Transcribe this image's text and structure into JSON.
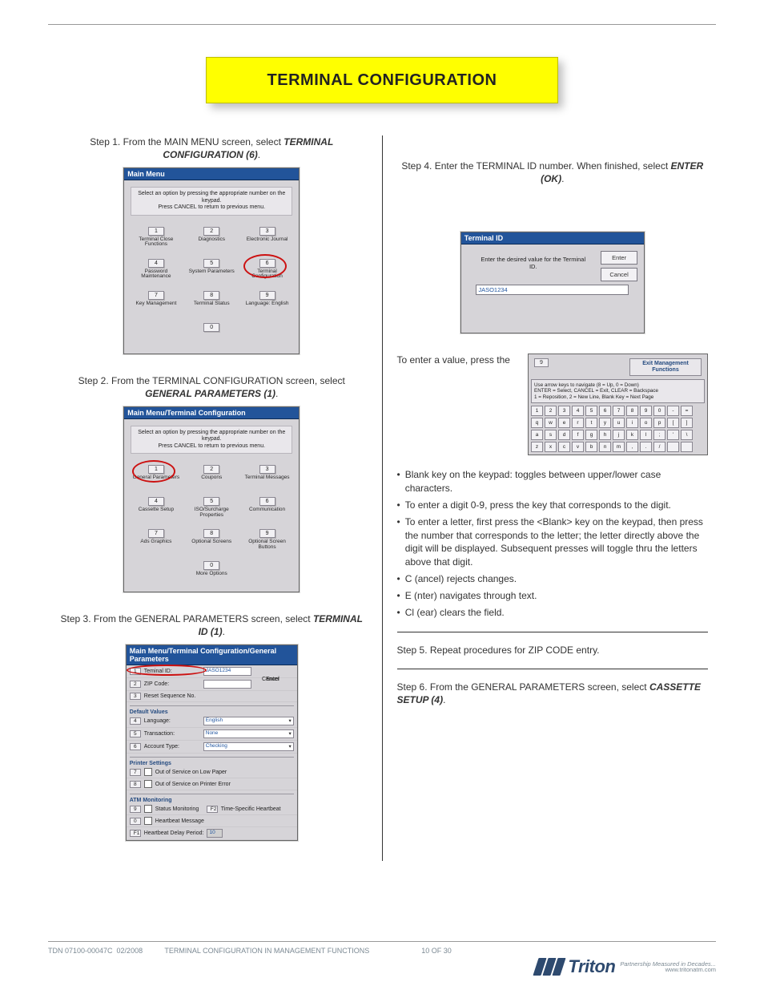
{
  "banner": "TERMINAL CONFIGURATION",
  "step1": {
    "cap_prefix": "Step 1. From the MAIN MENU screen, select ",
    "cap_hl": "TERMINAL CONFIGURATION (6)",
    "title": "Main Menu",
    "instr": "Select an option by pressing the appropriate number on the keypad.\nPress CANCEL to return to previous menu.",
    "cells": [
      {
        "n": "1",
        "l": "Terminal Close Functions"
      },
      {
        "n": "2",
        "l": "Diagnostics"
      },
      {
        "n": "3",
        "l": "Electronic Journal"
      },
      {
        "n": "4",
        "l": "Password Maintenance"
      },
      {
        "n": "5",
        "l": "System Parameters"
      },
      {
        "n": "6",
        "l": "Terminal Configuration"
      },
      {
        "n": "7",
        "l": "Key Management"
      },
      {
        "n": "8",
        "l": "Terminal Status"
      },
      {
        "n": "9",
        "l": "Language: English"
      },
      {
        "n": "",
        "l": ""
      },
      {
        "n": "0",
        "l": ""
      },
      {
        "n": "",
        "l": ""
      }
    ]
  },
  "step2": {
    "cap_prefix": "Step 2. From the TERMINAL CONFIGURATION screen, select ",
    "cap_hl": "GENERAL PARAMETERS (1)",
    "title": "Main Menu/Terminal Configuration",
    "instr": "Select an option by pressing the appropriate number on the keypad.\nPress CANCEL to return to previous menu.",
    "cells": [
      {
        "n": "1",
        "l": "General Parameters"
      },
      {
        "n": "2",
        "l": "Coupons"
      },
      {
        "n": "3",
        "l": "Terminal Messages"
      },
      {
        "n": "4",
        "l": "Cassette Setup"
      },
      {
        "n": "5",
        "l": "ISO/Surcharge Properties"
      },
      {
        "n": "6",
        "l": "Communication"
      },
      {
        "n": "7",
        "l": "Ads Graphics"
      },
      {
        "n": "8",
        "l": "Optional Screens"
      },
      {
        "n": "9",
        "l": "Optional Screen Buttons"
      },
      {
        "n": "",
        "l": ""
      },
      {
        "n": "0",
        "l": "More Options"
      },
      {
        "n": "",
        "l": ""
      }
    ]
  },
  "step3": {
    "cap_prefix": "Step 3. From the GENERAL PARAMETERS screen, select ",
    "cap_hl": "TERMINAL ID (1)",
    "title": "Main Menu/Terminal Configuration/General Parameters",
    "rows": [
      {
        "n": "1",
        "lab": "Teminal ID:",
        "val": "JASO1234"
      },
      {
        "n": "2",
        "lab": "ZIP Code:",
        "val": ""
      },
      {
        "n": "3",
        "lab": "Reset Sequence No.",
        "val": null
      }
    ],
    "btns": {
      "enter": "Enter",
      "cancel": "Cancel"
    },
    "sec_default": "Default Values",
    "defaults": [
      {
        "n": "4",
        "lab": "Language:",
        "val": "English"
      },
      {
        "n": "5",
        "lab": "Transaction:",
        "val": "None"
      },
      {
        "n": "6",
        "lab": "Account Type:",
        "val": "Checking"
      }
    ],
    "sec_printer": "Printer Settings",
    "printer": [
      {
        "n": "7",
        "lab": "Out of Service on Low Paper"
      },
      {
        "n": "8",
        "lab": "Out of Service on Printer Error"
      }
    ],
    "sec_atm": "ATM Monitoring",
    "atm_rows": {
      "r9": {
        "n": "9",
        "lab": "Status Monitoring"
      },
      "f2": {
        "n": "F2",
        "lab": "Time-Specific Heartbeat"
      },
      "r0": {
        "n": "0",
        "lab": "Heartbeat Message"
      },
      "f1": {
        "n": "F1",
        "lab": "Heartbeat Delay Period:",
        "val": "10"
      }
    }
  },
  "step4": {
    "cap_prefix": "Step 4. Enter the TERMINAL ID number. When finished, select ",
    "cap_hl": "ENTER (OK)",
    "title": "Terminal ID",
    "msg": "Enter the desired value for the Terminal ID.",
    "enter": "Enter",
    "cancel": "Cancel",
    "input": "JASO1234"
  },
  "bullet_intro": "To enter a value, press the",
  "bullets": [
    "Blank key on the keypad: toggles between upper/lower case characters.",
    "To enter a digit 0-9, press the key that corresponds to the digit.",
    "To enter a letter, first press the <Blank> key on the keypad, then press the number that corresponds to the letter; the letter directly above the digit will be displayed. Subsequent presses will toggle thru the letters above that digit.",
    "C (ancel) rejects changes.",
    "E (nter) navigates through text.",
    "Cl (ear) clears the field."
  ],
  "kb": {
    "nine": "9",
    "exit": "Exit Management Functions",
    "hints": "Use arrow keys to navigate (8 = Up, 0 = Down)\nENTER = Select, CANCEL = Exit, CLEAR = Backspace\n1 = Reposition, 2 = New Line, Blank Key = Next Page",
    "row1": [
      "1",
      "2",
      "3",
      "4",
      "5",
      "6",
      "7",
      "8",
      "9",
      "0",
      "-",
      "="
    ],
    "row2": [
      "q",
      "w",
      "e",
      "r",
      "t",
      "y",
      "u",
      "i",
      "o",
      "p",
      "[",
      "]"
    ],
    "row3": [
      "a",
      "s",
      "d",
      "f",
      "g",
      "h",
      "j",
      "k",
      "l",
      ";",
      "'",
      "\\"
    ],
    "row4": [
      "z",
      "x",
      "c",
      "v",
      "b",
      "n",
      "m",
      ",",
      ".",
      "/",
      " ",
      " "
    ]
  },
  "step5": "Step 5. Repeat procedures for ZIP CODE entry.",
  "step6_prefix": "Step 6. From the GENERAL PARAMETERS screen, select ",
  "step6_hl": "CASSETTE SETUP (4)",
  "footer": {
    "titleblock": "TDN 07100-00047C  02/2008           TERMINAL CONFIGURATION IN MANAGEMENT FUNCTIONS                          10 OF 30",
    "brand": "Triton",
    "tag1": "Partnership Measured in Decades...",
    "tag2": "www.tritonatm.com"
  }
}
